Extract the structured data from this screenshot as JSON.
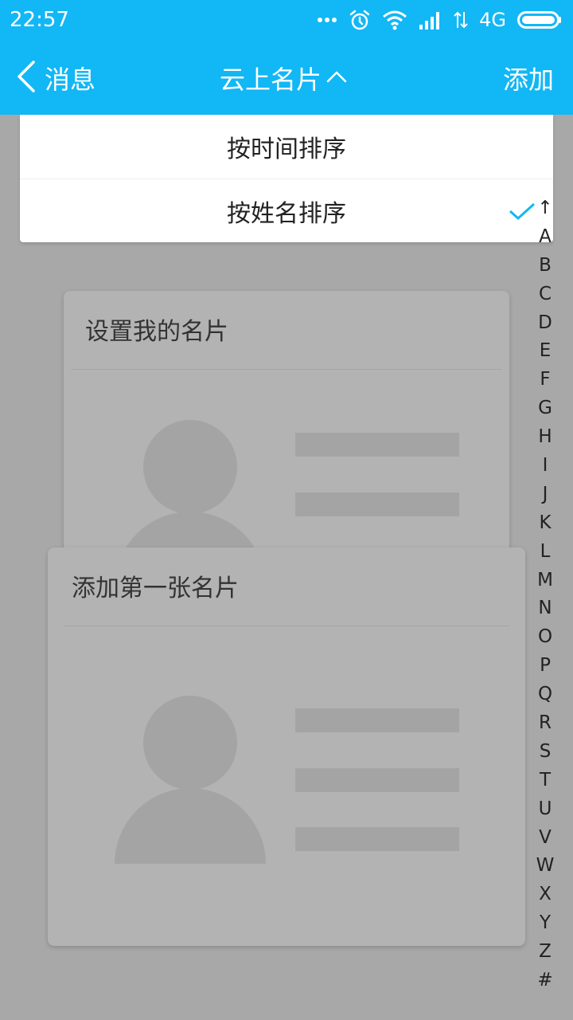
{
  "status_bar": {
    "time": "22:57",
    "network": "4G",
    "icons": [
      "more-dots-icon",
      "alarm-clock-icon",
      "wifi-icon",
      "signal-bars-icon",
      "data-transfer-icon",
      "battery-icon"
    ]
  },
  "nav": {
    "back_label": "消息",
    "title": "云上名片",
    "title_icon": "chevron-up-icon",
    "add_label": "添加"
  },
  "sort_menu": {
    "options": [
      {
        "label": "按时间排序",
        "selected": false
      },
      {
        "label": "按姓名排序",
        "selected": true
      }
    ]
  },
  "cards": {
    "my_card_title": "设置我的名片",
    "add_card_title": "添加第一张名片"
  },
  "alphabet_index": [
    "↑",
    "A",
    "B",
    "C",
    "D",
    "E",
    "F",
    "G",
    "H",
    "I",
    "J",
    "K",
    "L",
    "M",
    "N",
    "O",
    "P",
    "Q",
    "R",
    "S",
    "T",
    "U",
    "V",
    "W",
    "X",
    "Y",
    "Z",
    "#"
  ],
  "colors": {
    "accent": "#12b7f5",
    "overlay_background": "#a8a8a8",
    "card_background": "#b3b3b3",
    "placeholder_shape": "#a4a4a4"
  }
}
